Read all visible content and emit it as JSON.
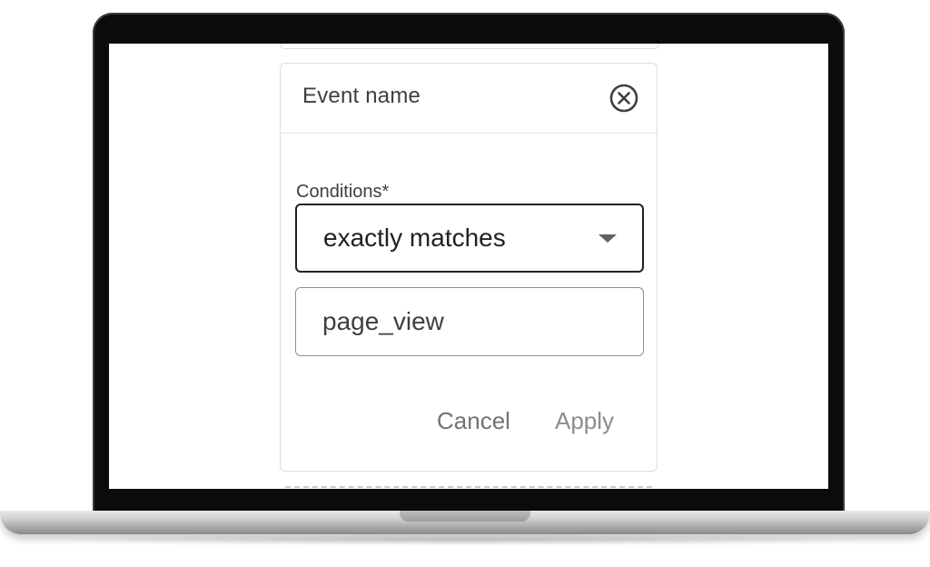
{
  "filter_card": {
    "title": "Event name",
    "close_icon": "close-circle-icon",
    "conditions_label": "Conditions*",
    "match_type": {
      "selected": "exactly matches"
    },
    "value_input": {
      "value": "page_view"
    },
    "cancel_label": "Cancel",
    "apply_label": "Apply"
  },
  "colors": {
    "text_primary": "#202124",
    "text_secondary": "#3c4043",
    "button_text": "#6f7378",
    "border": "#dadce0"
  }
}
